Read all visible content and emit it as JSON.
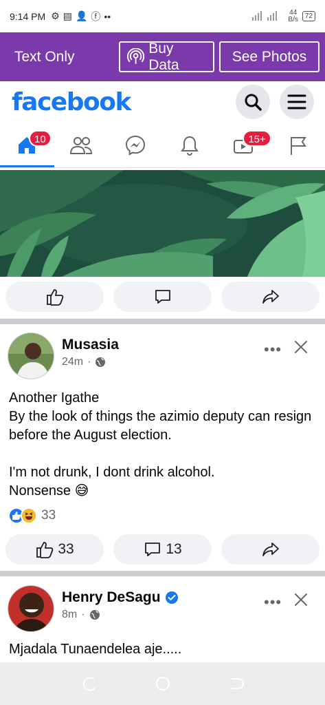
{
  "status_bar": {
    "time": "9:14 PM",
    "speed_value": "44",
    "speed_unit": "B/s",
    "battery": "72"
  },
  "banner": {
    "text_only": "Text Only",
    "buy_data": "Buy Data",
    "see_photos": "See Photos"
  },
  "header": {
    "logo": "facebook"
  },
  "nav": {
    "home_badge": "10",
    "video_badge": "15+"
  },
  "post1": {
    "author": "Musasia",
    "time": "24m",
    "lines": [
      "Another Igathe",
      "By the look of things the azimio deputy can resign before the August election.",
      "",
      "I'm not drunk,  I dont drink alcohol.",
      "Nonsense"
    ],
    "reaction_count": "33",
    "like_count": "33",
    "comment_count": "13"
  },
  "post2": {
    "author": "Henry DeSagu",
    "time": "8m",
    "text": "Mjadala Tunaendelea aje....."
  },
  "colors": {
    "facebook_blue": "#1877f2",
    "banner_purple": "#7b3aac",
    "badge_red": "#e41e3f"
  }
}
